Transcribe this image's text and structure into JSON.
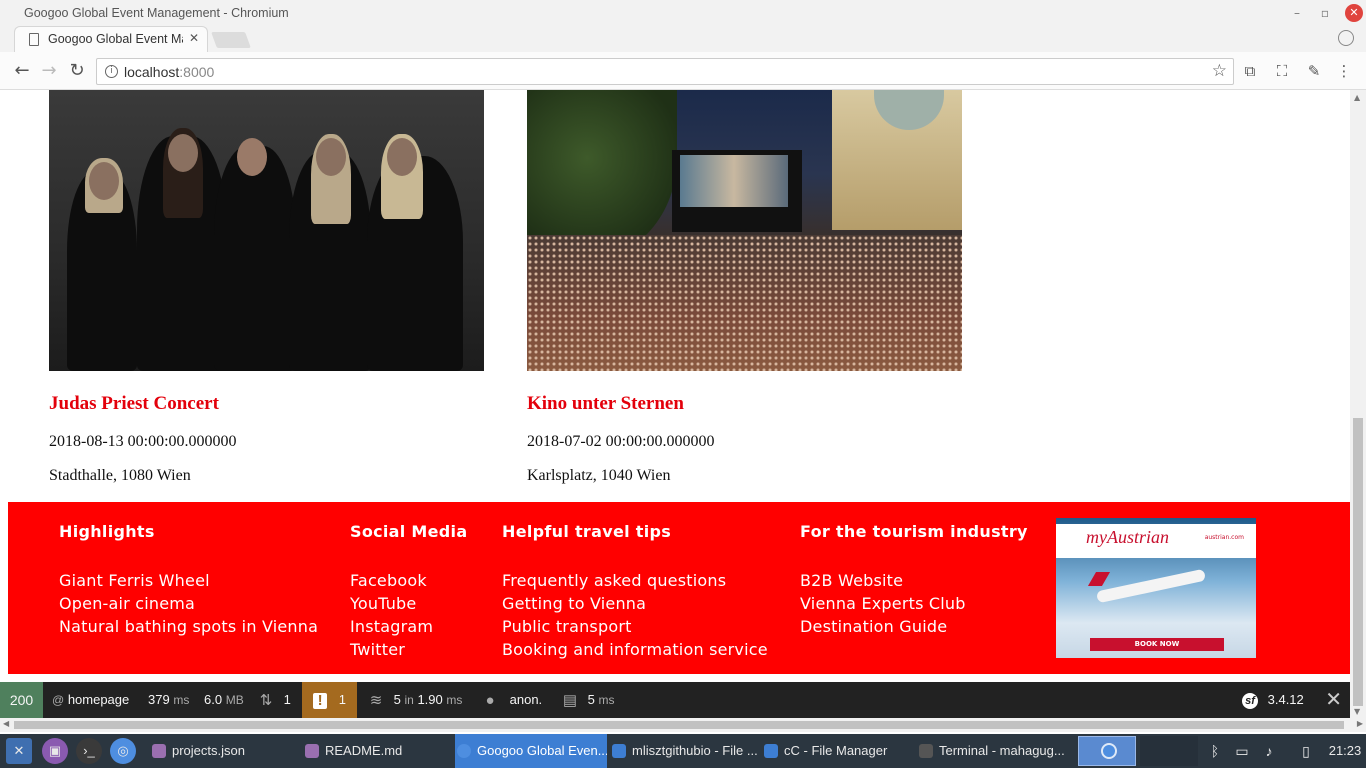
{
  "window": {
    "title": "Googoo Global Event Management - Chromium",
    "minimize_icon": "minimize-icon",
    "maximize_icon": "maximize-icon",
    "close_icon": "close-icon"
  },
  "tabs": [
    {
      "label": "Googoo Global Event Ma",
      "icon": "document-icon"
    }
  ],
  "toolbar": {
    "url_host": "localhost",
    "url_port": ":8000"
  },
  "events": [
    {
      "title": "Judas Priest Concert",
      "date": "2018-08-13 00:00:00.000000",
      "venue": "Stadthalle, 1080 Wien"
    },
    {
      "title": "Kino unter Sternen",
      "date": "2018-07-02 00:00:00.000000",
      "venue": "Karlsplatz, 1040 Wien"
    }
  ],
  "footer": {
    "columns": [
      {
        "heading": "Highlights",
        "links": [
          "Giant Ferris Wheel",
          "Open-air cinema",
          "Natural bathing spots in Vienna"
        ]
      },
      {
        "heading": "Social Media",
        "links": [
          "Facebook",
          "YouTube",
          "Instagram",
          "Twitter"
        ]
      },
      {
        "heading": "Helpful travel tips",
        "links": [
          "Frequently asked questions",
          "Getting to Vienna",
          "Public transport",
          "Booking and information service"
        ]
      },
      {
        "heading": "For the tourism industry",
        "links": [
          "B2B Website",
          "Vienna Experts Club",
          "Destination Guide"
        ]
      }
    ],
    "ad": {
      "logo": "myAustrian",
      "domain": "austrian.com",
      "button": "BOOK NOW"
    }
  },
  "debug_toolbar": {
    "status": "200",
    "route_prefix": "@",
    "route": "homepage",
    "time_value": "379",
    "time_unit": "ms",
    "memory_value": "6.0",
    "memory_unit": "MB",
    "forms_count": "1",
    "logs_count": "1",
    "queries_count": "5",
    "queries_in": "in",
    "queries_time": "1.90",
    "queries_unit": "ms",
    "user": "anon.",
    "twig_time": "5",
    "twig_unit": "ms",
    "symfony_version": "3.4.12"
  },
  "taskbar": {
    "tasks": [
      {
        "label": "projects.json",
        "color": "#9a6fb0"
      },
      {
        "label": "README.md",
        "color": "#9a6fb0"
      },
      {
        "label": "Googoo Global Even...",
        "color": "#4e8ee0",
        "active": true
      },
      {
        "label": "mlisztgithubio - File ...",
        "color": "#3d7ed3"
      },
      {
        "label": "cC - File Manager",
        "color": "#3d7ed3"
      },
      {
        "label": "Terminal - mahagug...",
        "color": "#555555"
      }
    ],
    "clock": "21:23"
  },
  "colors": {
    "accent_red": "#e3000b",
    "footer_red": "#ff0000",
    "debug_status_green": "#4f805d",
    "debug_warning": "#a46a1f"
  }
}
